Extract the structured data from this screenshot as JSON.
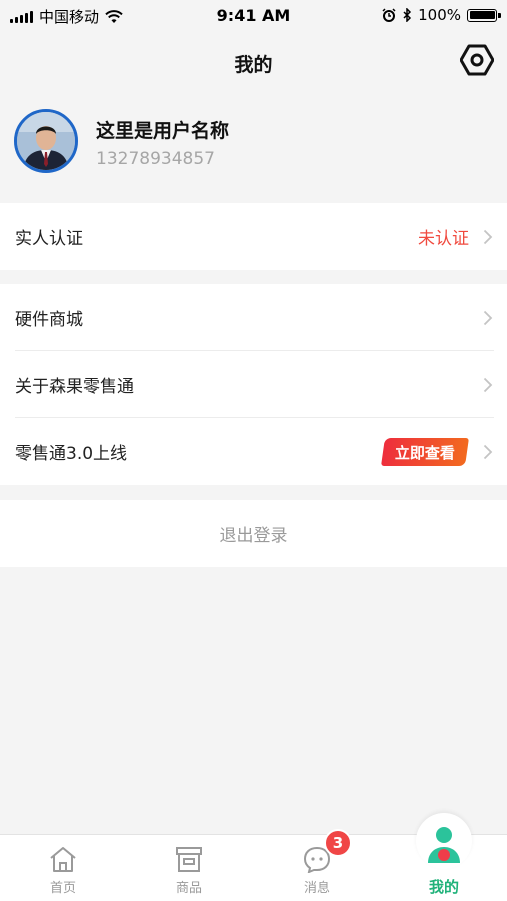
{
  "status_bar": {
    "carrier": "中国移动",
    "time": "9:41 AM",
    "battery": "100%"
  },
  "header": {
    "title": "我的"
  },
  "profile": {
    "name": "这里是用户名称",
    "phone": "13278934857"
  },
  "verification": {
    "label": "实人认证",
    "status": "未认证"
  },
  "menu": {
    "items": [
      {
        "label": "硬件商城"
      },
      {
        "label": "关于森果零售通"
      },
      {
        "label": "零售通3.0上线",
        "badge": "立即查看"
      }
    ]
  },
  "logout": {
    "label": "退出登录"
  },
  "tabbar": {
    "tabs": [
      {
        "label": "首页"
      },
      {
        "label": "商品"
      },
      {
        "label": "消息",
        "badge": "3"
      },
      {
        "label": "我的"
      }
    ]
  },
  "colors": {
    "accent": "#20b27a",
    "alert": "#f04a3f",
    "badge": "#f04646"
  }
}
